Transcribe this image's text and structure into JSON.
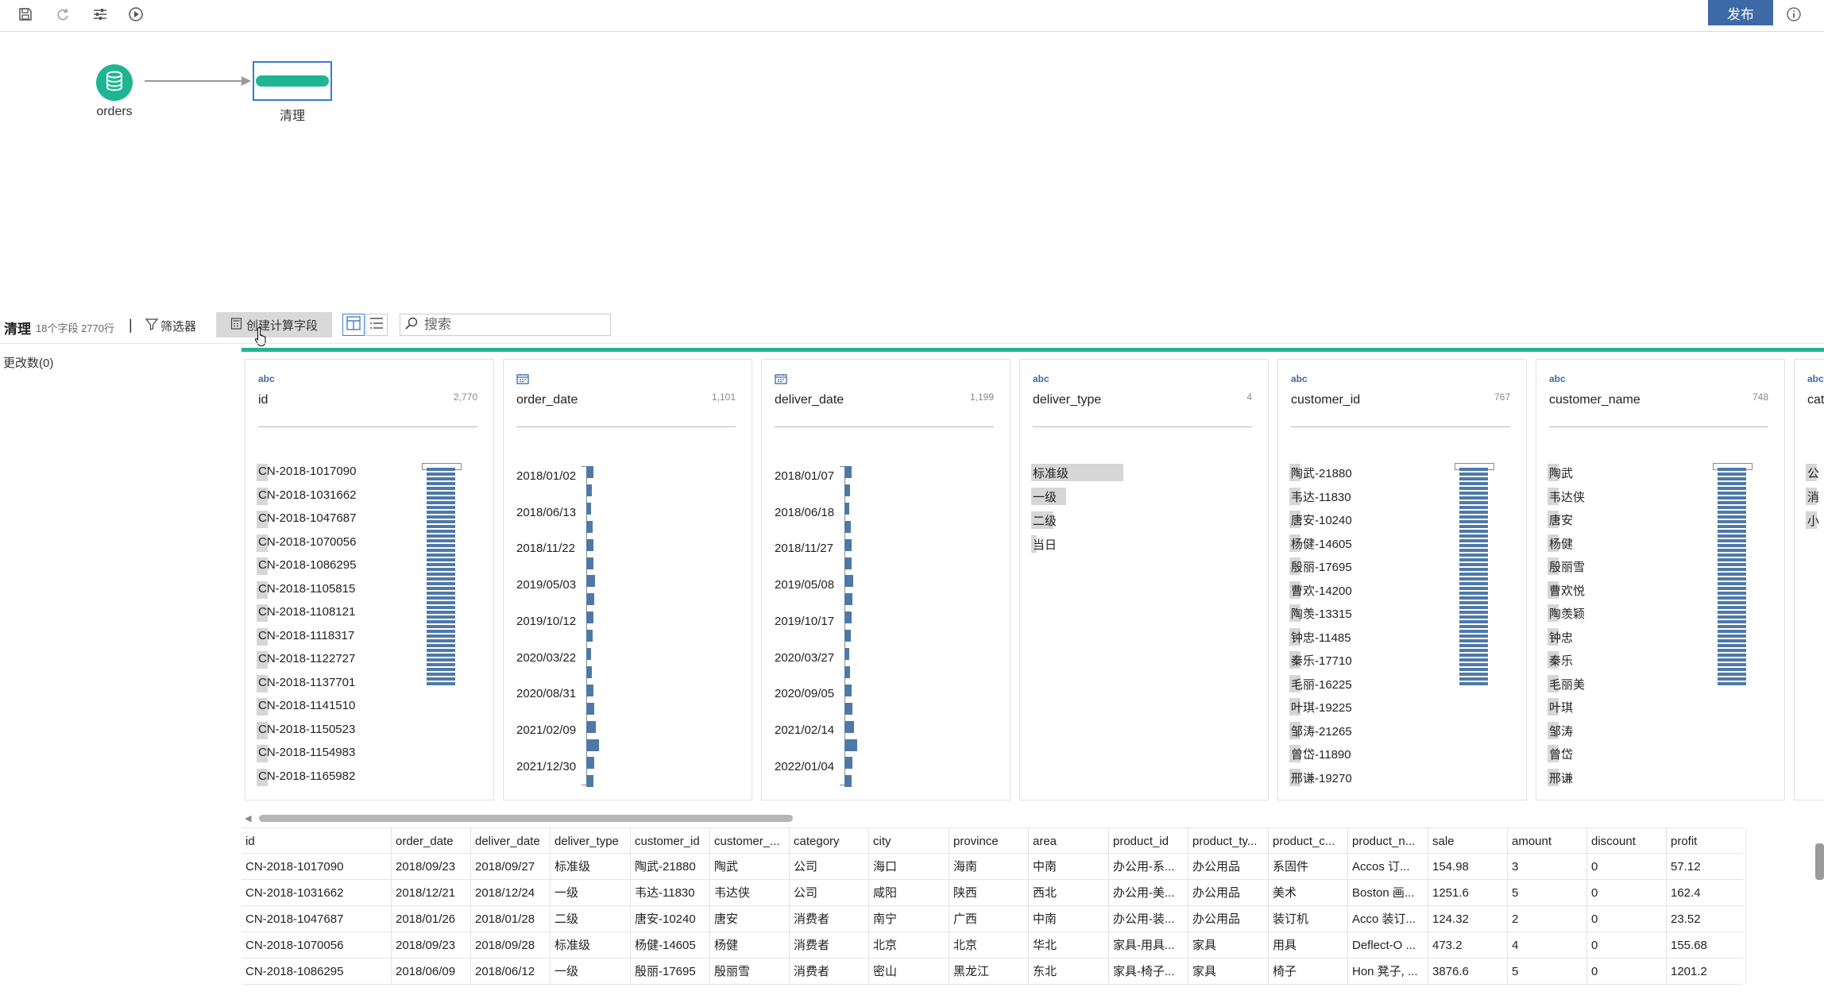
{
  "toolbar": {
    "icons": [
      "save-icon",
      "refresh-icon",
      "settings-sliders-icon",
      "run-icon"
    ],
    "publish_label": "发布",
    "info_icon": "info-icon"
  },
  "flow": {
    "source_node_label": "orders",
    "clean_node_label": "清理"
  },
  "filterbar": {
    "title": "清理",
    "meta": "18个字段  2770行",
    "separator": "|",
    "filter_label": "筛选器",
    "calc_label": "创建计算字段",
    "search_placeholder": "搜索"
  },
  "changes_label": "更改数(0)",
  "accent_color": "#1fb592",
  "bar_color": "#4e79a7",
  "publish_color": "#3d6aa6",
  "cards": [
    {
      "type": "abc",
      "name": "id",
      "count": "2,770",
      "kind": "list",
      "values": [
        "CN-2018-1017090",
        "CN-2018-1031662",
        "CN-2018-1047687",
        "CN-2018-1070056",
        "CN-2018-1086295",
        "CN-2018-1105815",
        "CN-2018-1108121",
        "CN-2018-1118317",
        "CN-2018-1122727",
        "CN-2018-1137701",
        "CN-2018-1141510",
        "CN-2018-1150523",
        "CN-2018-1154983",
        "CN-2018-1165982"
      ]
    },
    {
      "type": "date",
      "name": "order_date",
      "count": "1,101",
      "kind": "date",
      "values": [
        "2018/01/02",
        "2018/06/13",
        "2018/11/22",
        "2019/05/03",
        "2019/10/12",
        "2020/03/22",
        "2020/08/31",
        "2021/02/09",
        "2021/12/30"
      ]
    },
    {
      "type": "date",
      "name": "deliver_date",
      "count": "1,199",
      "kind": "date",
      "values": [
        "2018/01/07",
        "2018/06/18",
        "2018/11/27",
        "2019/05/08",
        "2019/10/17",
        "2020/03/27",
        "2020/09/05",
        "2021/02/14",
        "2022/01/04"
      ]
    },
    {
      "type": "abc",
      "name": "deliver_type",
      "count": "4",
      "kind": "category",
      "values": [
        "标准级",
        "一级",
        "二级",
        "当日"
      ],
      "shares": [
        1.0,
        0.38,
        0.24,
        0.06
      ]
    },
    {
      "type": "abc",
      "name": "customer_id",
      "count": "767",
      "kind": "list",
      "values": [
        "陶武-21880",
        "韦达-11830",
        "唐安-10240",
        "杨健-14605",
        "殷丽-17695",
        "曹欢-14200",
        "陶羡-13315",
        "钟忠-11485",
        "秦乐-17710",
        "毛丽-16225",
        "叶琪-19225",
        "邹涛-21265",
        "曾岱-11890",
        "邢谦-19270"
      ]
    },
    {
      "type": "abc",
      "name": "customer_name",
      "count": "748",
      "kind": "list",
      "values": [
        "陶武",
        "韦达侠",
        "唐安",
        "杨健",
        "殷丽雪",
        "曹欢悦",
        "陶羡颖",
        "钟忠",
        "秦乐",
        "毛丽美",
        "叶琪",
        "邹涛",
        "曾岱",
        "邢谦"
      ]
    },
    {
      "type": "abc",
      "name": "cat",
      "count": "",
      "kind": "partial",
      "values": [
        "公",
        "消",
        "小"
      ]
    }
  ],
  "table": {
    "columns": [
      "id",
      "order_date",
      "deliver_date",
      "deliver_type",
      "customer_id",
      "customer_...",
      "category",
      "city",
      "province",
      "area",
      "product_id",
      "product_ty...",
      "product_c...",
      "product_n...",
      "sale",
      "amount",
      "discount",
      "profit"
    ],
    "rows": [
      [
        "CN-2018-1017090",
        "2018/09/23",
        "2018/09/27",
        "标准级",
        "陶武-21880",
        "陶武",
        "公司",
        "海口",
        "海南",
        "中南",
        "办公用-系...",
        "办公用品",
        "系固件",
        "Accos 订...",
        "154.98",
        "3",
        "0",
        "57.12"
      ],
      [
        "CN-2018-1031662",
        "2018/12/21",
        "2018/12/24",
        "一级",
        "韦达-11830",
        "韦达侠",
        "公司",
        "咸阳",
        "陕西",
        "西北",
        "办公用-美...",
        "办公用品",
        "美术",
        "Boston 画...",
        "1251.6",
        "5",
        "0",
        "162.4"
      ],
      [
        "CN-2018-1047687",
        "2018/01/26",
        "2018/01/28",
        "二级",
        "唐安-10240",
        "唐安",
        "消费者",
        "南宁",
        "广西",
        "中南",
        "办公用-装...",
        "办公用品",
        "装订机",
        "Acco 装订...",
        "124.32",
        "2",
        "0",
        "23.52"
      ],
      [
        "CN-2018-1070056",
        "2018/09/23",
        "2018/09/28",
        "标准级",
        "杨健-14605",
        "杨健",
        "消费者",
        "北京",
        "北京",
        "华北",
        "家具-用具...",
        "家具",
        "用具",
        "Deflect-O ...",
        "473.2",
        "4",
        "0",
        "155.68"
      ],
      [
        "CN-2018-1086295",
        "2018/06/09",
        "2018/06/12",
        "一级",
        "殷丽-17695",
        "殷丽雪",
        "消费者",
        "密山",
        "黑龙江",
        "东北",
        "家具-椅子...",
        "家具",
        "椅子",
        "Hon 凳子, ...",
        "3876.6",
        "5",
        "0",
        "1201.2"
      ]
    ]
  }
}
